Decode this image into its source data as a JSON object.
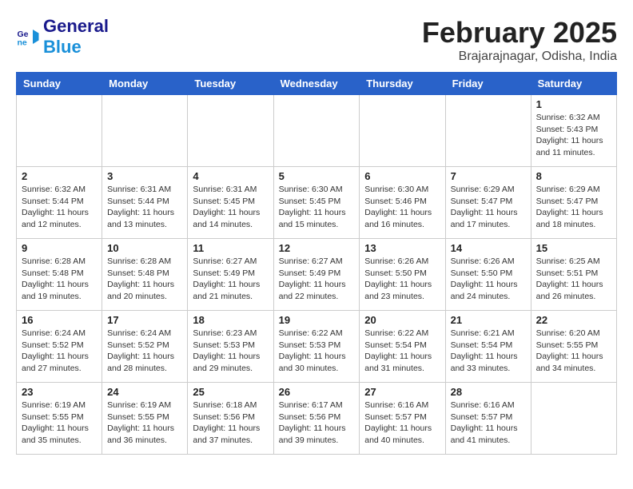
{
  "header": {
    "logo_general": "General",
    "logo_blue": "Blue",
    "title": "February 2025",
    "subtitle": "Brajarajnagar, Odisha, India"
  },
  "weekdays": [
    "Sunday",
    "Monday",
    "Tuesday",
    "Wednesday",
    "Thursday",
    "Friday",
    "Saturday"
  ],
  "weeks": [
    [
      {
        "day": "",
        "info": ""
      },
      {
        "day": "",
        "info": ""
      },
      {
        "day": "",
        "info": ""
      },
      {
        "day": "",
        "info": ""
      },
      {
        "day": "",
        "info": ""
      },
      {
        "day": "",
        "info": ""
      },
      {
        "day": "1",
        "info": "Sunrise: 6:32 AM\nSunset: 5:43 PM\nDaylight: 11 hours and 11 minutes."
      }
    ],
    [
      {
        "day": "2",
        "info": "Sunrise: 6:32 AM\nSunset: 5:44 PM\nDaylight: 11 hours and 12 minutes."
      },
      {
        "day": "3",
        "info": "Sunrise: 6:31 AM\nSunset: 5:44 PM\nDaylight: 11 hours and 13 minutes."
      },
      {
        "day": "4",
        "info": "Sunrise: 6:31 AM\nSunset: 5:45 PM\nDaylight: 11 hours and 14 minutes."
      },
      {
        "day": "5",
        "info": "Sunrise: 6:30 AM\nSunset: 5:45 PM\nDaylight: 11 hours and 15 minutes."
      },
      {
        "day": "6",
        "info": "Sunrise: 6:30 AM\nSunset: 5:46 PM\nDaylight: 11 hours and 16 minutes."
      },
      {
        "day": "7",
        "info": "Sunrise: 6:29 AM\nSunset: 5:47 PM\nDaylight: 11 hours and 17 minutes."
      },
      {
        "day": "8",
        "info": "Sunrise: 6:29 AM\nSunset: 5:47 PM\nDaylight: 11 hours and 18 minutes."
      }
    ],
    [
      {
        "day": "9",
        "info": "Sunrise: 6:28 AM\nSunset: 5:48 PM\nDaylight: 11 hours and 19 minutes."
      },
      {
        "day": "10",
        "info": "Sunrise: 6:28 AM\nSunset: 5:48 PM\nDaylight: 11 hours and 20 minutes."
      },
      {
        "day": "11",
        "info": "Sunrise: 6:27 AM\nSunset: 5:49 PM\nDaylight: 11 hours and 21 minutes."
      },
      {
        "day": "12",
        "info": "Sunrise: 6:27 AM\nSunset: 5:49 PM\nDaylight: 11 hours and 22 minutes."
      },
      {
        "day": "13",
        "info": "Sunrise: 6:26 AM\nSunset: 5:50 PM\nDaylight: 11 hours and 23 minutes."
      },
      {
        "day": "14",
        "info": "Sunrise: 6:26 AM\nSunset: 5:50 PM\nDaylight: 11 hours and 24 minutes."
      },
      {
        "day": "15",
        "info": "Sunrise: 6:25 AM\nSunset: 5:51 PM\nDaylight: 11 hours and 26 minutes."
      }
    ],
    [
      {
        "day": "16",
        "info": "Sunrise: 6:24 AM\nSunset: 5:52 PM\nDaylight: 11 hours and 27 minutes."
      },
      {
        "day": "17",
        "info": "Sunrise: 6:24 AM\nSunset: 5:52 PM\nDaylight: 11 hours and 28 minutes."
      },
      {
        "day": "18",
        "info": "Sunrise: 6:23 AM\nSunset: 5:53 PM\nDaylight: 11 hours and 29 minutes."
      },
      {
        "day": "19",
        "info": "Sunrise: 6:22 AM\nSunset: 5:53 PM\nDaylight: 11 hours and 30 minutes."
      },
      {
        "day": "20",
        "info": "Sunrise: 6:22 AM\nSunset: 5:54 PM\nDaylight: 11 hours and 31 minutes."
      },
      {
        "day": "21",
        "info": "Sunrise: 6:21 AM\nSunset: 5:54 PM\nDaylight: 11 hours and 33 minutes."
      },
      {
        "day": "22",
        "info": "Sunrise: 6:20 AM\nSunset: 5:55 PM\nDaylight: 11 hours and 34 minutes."
      }
    ],
    [
      {
        "day": "23",
        "info": "Sunrise: 6:19 AM\nSunset: 5:55 PM\nDaylight: 11 hours and 35 minutes."
      },
      {
        "day": "24",
        "info": "Sunrise: 6:19 AM\nSunset: 5:55 PM\nDaylight: 11 hours and 36 minutes."
      },
      {
        "day": "25",
        "info": "Sunrise: 6:18 AM\nSunset: 5:56 PM\nDaylight: 11 hours and 37 minutes."
      },
      {
        "day": "26",
        "info": "Sunrise: 6:17 AM\nSunset: 5:56 PM\nDaylight: 11 hours and 39 minutes."
      },
      {
        "day": "27",
        "info": "Sunrise: 6:16 AM\nSunset: 5:57 PM\nDaylight: 11 hours and 40 minutes."
      },
      {
        "day": "28",
        "info": "Sunrise: 6:16 AM\nSunset: 5:57 PM\nDaylight: 11 hours and 41 minutes."
      },
      {
        "day": "",
        "info": ""
      }
    ]
  ]
}
